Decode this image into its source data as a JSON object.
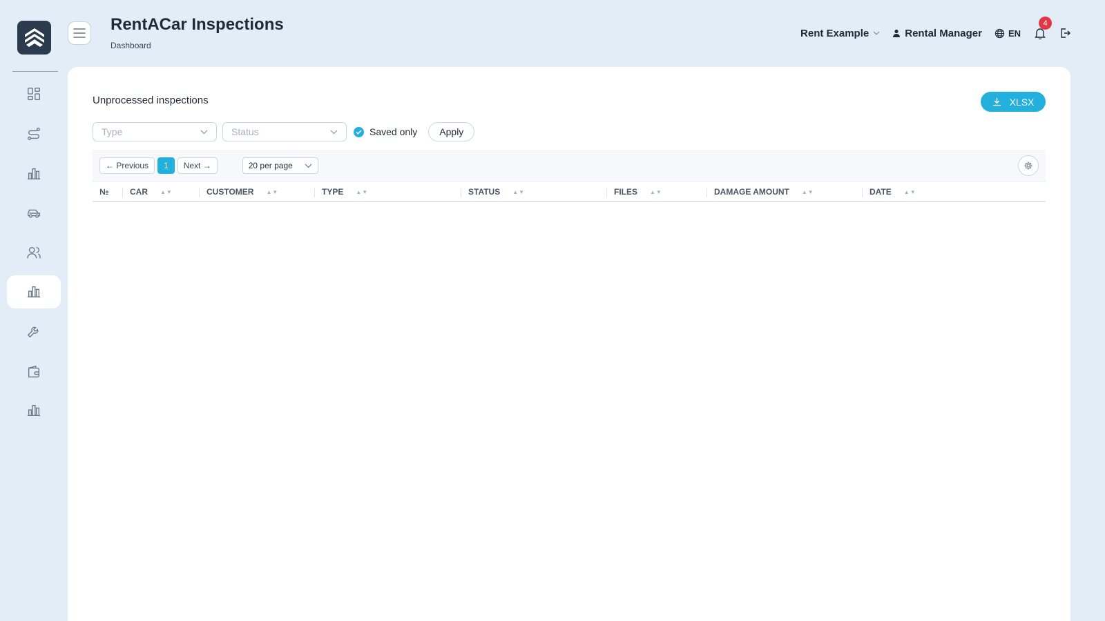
{
  "app": {
    "title": "RentACar Inspections",
    "breadcrumb": "Dashboard"
  },
  "header": {
    "company": "Rent Example",
    "user": "Rental Manager",
    "language": "EN",
    "notification_count": "4"
  },
  "sidebar": {
    "items": [
      {
        "name": "dashboard",
        "icon": "grid-icon"
      },
      {
        "name": "routes",
        "icon": "route-icon"
      },
      {
        "name": "reports",
        "icon": "bar-chart-icon"
      },
      {
        "name": "cars",
        "icon": "car-icon"
      },
      {
        "name": "customers",
        "icon": "users-icon"
      },
      {
        "name": "inspections",
        "icon": "bar-chart-icon",
        "active": true
      },
      {
        "name": "service",
        "icon": "wrench-icon"
      },
      {
        "name": "payments",
        "icon": "wallet-icon"
      },
      {
        "name": "statistics",
        "icon": "bar-chart-icon"
      }
    ]
  },
  "main": {
    "section_title": "Unprocessed inspections",
    "export_label": "XLSX",
    "filters": {
      "type_placeholder": "Type",
      "status_placeholder": "Status",
      "saved_only_label": "Saved only",
      "saved_only_checked": true,
      "apply_label": "Apply"
    },
    "pagination": {
      "previous_label": "← Previous",
      "current_page": "1",
      "next_label": "Next →",
      "per_page": "20 per page"
    },
    "table": {
      "columns": [
        "№",
        "CAR",
        "CUSTOMER",
        "TYPE",
        "STATUS",
        "FILES",
        "DAMAGE AMOUNT",
        "DATE"
      ],
      "rows": []
    }
  },
  "colors": {
    "accent": "#23b0dc",
    "background": "#e3edf7",
    "badge": "#e23744",
    "logo": "#2b3a4c"
  }
}
